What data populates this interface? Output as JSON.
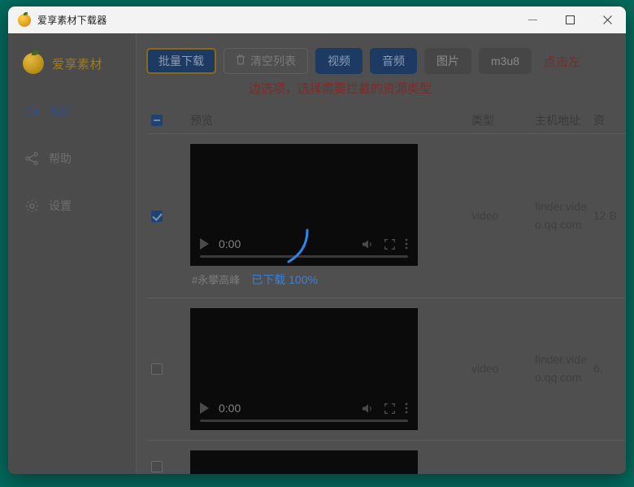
{
  "window": {
    "title": "爱享素材下载器",
    "icon": "orange-fruit-icon",
    "controls": {
      "minimize": "minimize-icon",
      "maximize": "maximize-icon",
      "close": "close-icon"
    }
  },
  "desktop": {
    "background_color": "#046a5d"
  },
  "sidebar": {
    "brand": {
      "name": "爱享素材",
      "logo": "orange-fruit-logo"
    },
    "items": [
      {
        "label": "嗅探",
        "icon": "video-camera-icon",
        "active": true
      },
      {
        "label": "帮助",
        "icon": "share-nodes-icon",
        "active": false
      },
      {
        "label": "设置",
        "icon": "gear-icon",
        "active": false
      }
    ]
  },
  "toolbar": {
    "batch_download": "批量下载",
    "clear_list": "清空列表",
    "clear_list_icon": "trash-icon",
    "filters": [
      {
        "label": "视频",
        "active": true
      },
      {
        "label": "音频",
        "active": true
      },
      {
        "label": "图片",
        "active": false
      },
      {
        "label": "m3u8",
        "active": false
      }
    ],
    "annotation_line1": "点击左",
    "annotation_line2": "边选项，选择需要拦截的资源类型",
    "annotation_color": "#7e2a2a",
    "accent_blue": "#1d3a63",
    "focus_gold": "#8a6a17"
  },
  "table": {
    "headers": {
      "preview": "预览",
      "type": "类型",
      "host": "主机地址",
      "size": "资"
    },
    "select_all_state": "indeterminate",
    "rows": [
      {
        "checked": true,
        "player": {
          "time": "0:00",
          "play_icon": "play-icon",
          "volume_icon": "volume-icon",
          "fullscreen_icon": "fullscreen-icon",
          "more_icon": "more-vertical-icon",
          "has_spinner": true,
          "tall": true
        },
        "caption": "#永攀高峰",
        "status": "已下载 100%",
        "status_color": "#3f7fd0",
        "type": "video",
        "host": "finder.video.qq.com",
        "size": "12 B"
      },
      {
        "checked": false,
        "player": {
          "time": "0:00",
          "play_icon": "play-icon",
          "volume_icon": "volume-icon",
          "fullscreen_icon": "fullscreen-icon",
          "more_icon": "more-vertical-icon",
          "has_spinner": false,
          "tall": true
        },
        "caption": "",
        "status": "",
        "status_color": "#3f7fd0",
        "type": "video",
        "host": "finder.video.qq.com",
        "size": "6."
      },
      {
        "checked": false,
        "player": {
          "time": "",
          "play_icon": "play-icon",
          "volume_icon": "volume-icon",
          "fullscreen_icon": "fullscreen-icon",
          "more_icon": "more-vertical-icon",
          "has_spinner": false,
          "tall": false
        },
        "caption": "",
        "status": "",
        "status_color": "#3f7fd0",
        "type": "",
        "host": "",
        "size": ""
      }
    ]
  }
}
